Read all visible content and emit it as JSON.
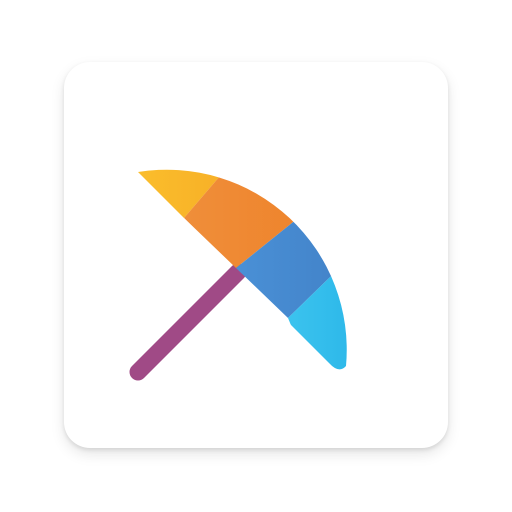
{
  "icon": {
    "name": "umbrella-icon",
    "colors": {
      "canopy_band_1": [
        "#FBC02D",
        "#F5A623"
      ],
      "canopy_band_2": [
        "#EF8E3A",
        "#EE7A1E"
      ],
      "canopy_band_3": [
        "#4A90D6",
        "#3C78BE"
      ],
      "canopy_band_4": [
        "#3BC3EE",
        "#1AA9E3"
      ],
      "handle": "#A04A86",
      "tile_background": "#FFFFFF"
    }
  }
}
